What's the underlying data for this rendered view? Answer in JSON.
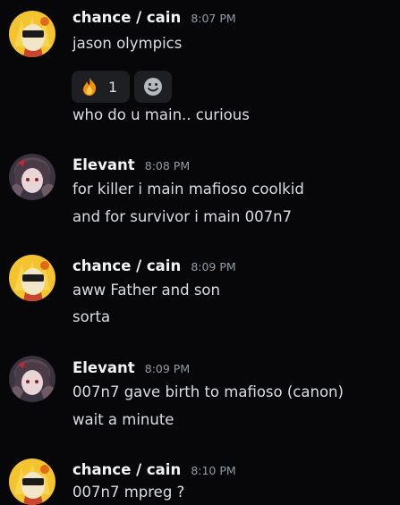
{
  "messages": [
    {
      "username": "chance / cain",
      "timestamp": "8:07 PM",
      "avatar_icon": "chance-avatar-icon",
      "lines": [
        "jason olympics",
        "who do u main.. curious"
      ],
      "reactions": [
        {
          "emoji": "🔥",
          "icon": "fire-emoji-icon",
          "count": "1"
        }
      ],
      "add_reaction_icon": "add-reaction-smiley-icon"
    },
    {
      "username": "Elevant",
      "timestamp": "8:08 PM",
      "avatar_icon": "elevant-avatar-icon",
      "lines": [
        "for killer i main mafioso coolkid",
        "and for survivor i main 007n7"
      ]
    },
    {
      "username": "chance / cain",
      "timestamp": "8:09 PM",
      "avatar_icon": "chance-avatar-icon",
      "lines": [
        "aww Father and son",
        "sorta"
      ]
    },
    {
      "username": "Elevant",
      "timestamp": "8:09 PM",
      "avatar_icon": "elevant-avatar-icon",
      "lines": [
        "007n7 gave birth to mafioso (canon)",
        "wait a minute"
      ]
    },
    {
      "username": "chance / cain",
      "timestamp": "8:10 PM",
      "avatar_icon": "chance-avatar-icon",
      "lines": [
        "007n7 mpreg ?"
      ]
    }
  ],
  "colors": {
    "background": "#070709",
    "username": "#f2f3f5",
    "timestamp": "#949ba4",
    "reaction_bg": "#1e1f22",
    "chance_avatar": "#f4c430",
    "elevant_avatar": "#3a3340"
  }
}
